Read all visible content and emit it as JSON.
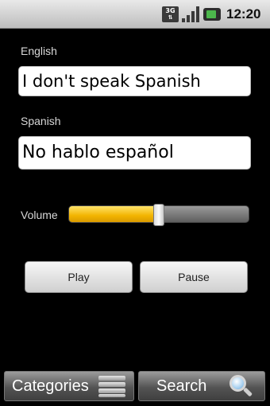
{
  "status_bar": {
    "network": "3G",
    "time": "12:20"
  },
  "english": {
    "label": "English",
    "value": "I don't speak Spanish"
  },
  "spanish": {
    "label": "Spanish",
    "value": "No hablo español"
  },
  "volume": {
    "label": "Volume",
    "level": 0.5
  },
  "buttons": {
    "play": "Play",
    "pause": "Pause"
  },
  "tabs": {
    "categories": "Categories",
    "search": "Search"
  },
  "colors": {
    "slider_fill": "#f2b400",
    "background": "#000000"
  },
  "icons": {
    "network": "3g-icon",
    "signal": "signal-strength-icon",
    "battery": "battery-icon",
    "categories": "list-icon",
    "search": "search-icon"
  }
}
